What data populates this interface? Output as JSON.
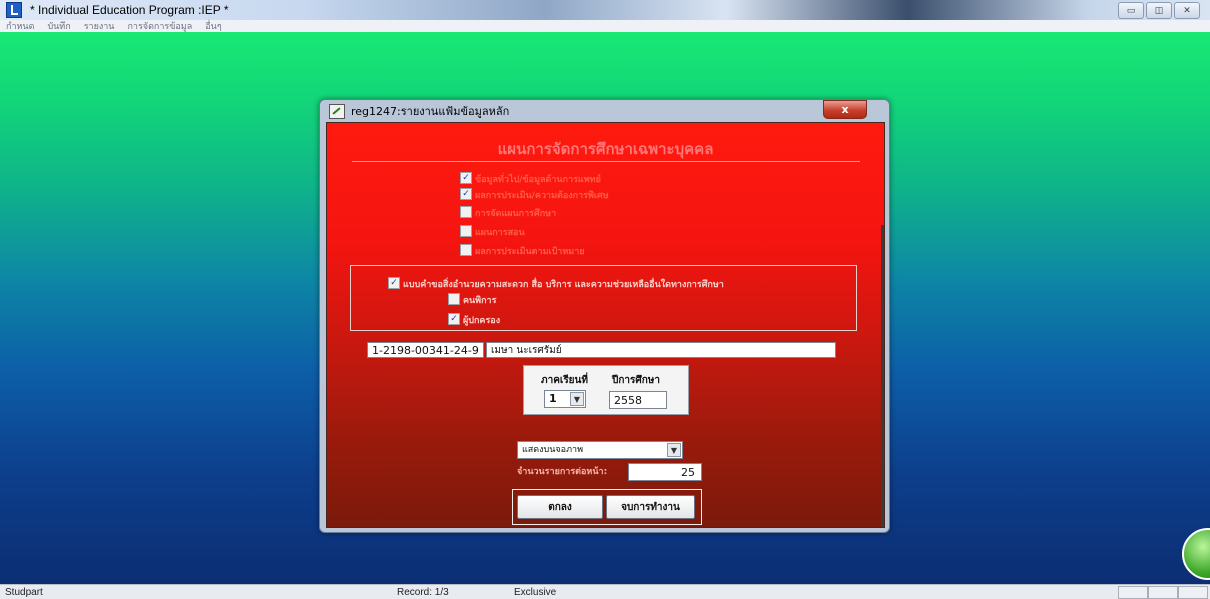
{
  "window": {
    "title": "* Individual Education Program :IEP *",
    "controls": {
      "minimize": "▭",
      "maximize": "◫",
      "close": "✕"
    }
  },
  "menu": [
    "กำหนด",
    "บันทึก",
    "รายงาน",
    "การจัดการข้อมูล",
    "อื่นๆ"
  ],
  "dialog": {
    "title": "reg1247:รายงานแฟ้มข้อมูลหลัก",
    "close": "x",
    "heading": "แผนการจัดการศึกษาเฉพาะบุคคล",
    "options": [
      {
        "label": "ข้อมูลทั่วไป/ข้อมูลด้านการแพทย์",
        "checked": true
      },
      {
        "label": "ผลการประเมิน/ความต้องการพิเศษ",
        "checked": true
      },
      {
        "label": "การจัดแผนการศึกษา",
        "checked": false
      },
      {
        "label": "แผนการสอน",
        "checked": false
      },
      {
        "label": "ผลการประเมินตามเป้าหมาย",
        "checked": false
      }
    ],
    "group": {
      "main": {
        "label": "แบบคำขอสิ่งอำนวยความสะดวก สื่อ บริการ และความช่วยเหลืออื่นใดทางการศึกษา",
        "checked": true
      },
      "sub": [
        {
          "label": "คนพิการ",
          "checked": false
        },
        {
          "label": "ผู้ปกครอง",
          "checked": true
        }
      ]
    },
    "student_id": "1-2198-00341-24-9",
    "student_name": "เมษา นะเรศรัมย์",
    "term_label": "ภาคเรียนที่",
    "year_label": "ปีการศึกษา",
    "term_value": "1",
    "year_value": "2558",
    "output_option": "แสดงบนจอภาพ",
    "rows_label": "จำนวนรายการต่อหน้า:",
    "rows_value": "25",
    "ok_label": "ตกลง",
    "exit_label": "จบการทำงาน"
  },
  "status": {
    "form": "Studpart",
    "record": "Record: 1/3",
    "mode": "Exclusive"
  },
  "colors": {
    "workspace_top": "#18e874",
    "workspace_bottom": "#0c2d73",
    "dialog_red": "#ff1a0f",
    "dialog_dark_red": "#7a1a0c"
  }
}
